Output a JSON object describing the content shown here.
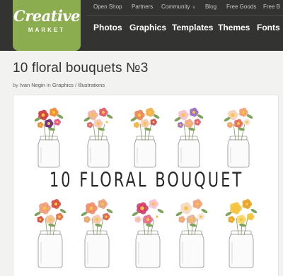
{
  "brand": {
    "name": "Creative",
    "sub": "MARKET",
    "color": "#8bac4f"
  },
  "topnav": [
    "Open Shop",
    "Partners",
    "Community",
    "Blog",
    "Free Goods",
    "Free B"
  ],
  "mainnav": [
    "Photos",
    "Graphics",
    "Templates",
    "Themes",
    "Fonts"
  ],
  "product": {
    "title": "10 floral bouquets №3",
    "by": "by",
    "author": "Ivan Negin",
    "in": "in",
    "category": "Graphics",
    "sep": "/",
    "subcategory": "Illustrations",
    "banner": "10 FLORAL BOUQUET"
  },
  "icons": {
    "community_chevron": "chevron-down-icon"
  }
}
